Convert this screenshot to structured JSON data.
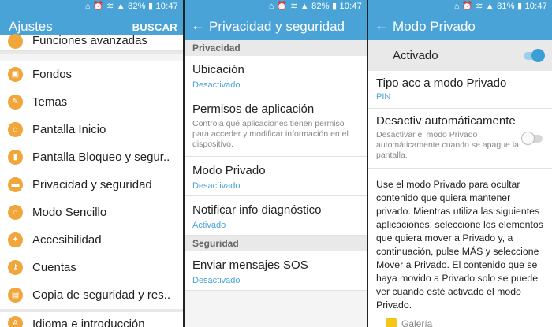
{
  "status": {
    "left_text": "⌂ ⏰ ≋ ▲ 82% ▮ 10:47",
    "mid_text": "⌂ ⏰ ≋ ▲ 82% ▮ 10:47",
    "right_text": "⌂ ⏰ ≋ ▲ 81% ▮ 10:47"
  },
  "colors": {
    "accent": "#4aa3d6",
    "icon": "#f0a63a"
  },
  "settings": {
    "title": "Ajustes",
    "search_label": "BUSCAR",
    "partial_top": "Funciones avanzadas",
    "items": [
      {
        "label": "Fondos",
        "icon": "wallpaper-icon"
      },
      {
        "label": "Temas",
        "icon": "brush-icon"
      },
      {
        "label": "Pantalla Inicio",
        "icon": "home-icon"
      },
      {
        "label": "Pantalla Bloqueo y segur..",
        "icon": "lock-icon"
      },
      {
        "label": "Privacidad y seguridad",
        "icon": "shield-icon"
      },
      {
        "label": "Modo Sencillo",
        "icon": "home-easy-icon"
      },
      {
        "label": "Accesibilidad",
        "icon": "accessibility-icon"
      },
      {
        "label": "Cuentas",
        "icon": "key-icon"
      },
      {
        "label": "Copia de seguridad y res..",
        "icon": "backup-icon"
      }
    ],
    "partial_bottom": "Idioma e introducción"
  },
  "privacy": {
    "title": "Privacidad y seguridad",
    "section_privacy": "Privacidad",
    "section_security": "Seguridad",
    "location": {
      "title": "Ubicación",
      "value": "Desactivado"
    },
    "permissions": {
      "title": "Permisos de aplicación",
      "desc": "Controla qué aplicaciones tienen permiso para acceder y modificar información en el dispositivo."
    },
    "private_mode": {
      "title": "Modo Privado",
      "value": "Desactivado"
    },
    "diagnostics": {
      "title": "Notificar info diagnóstico",
      "value": "Activado"
    },
    "sos": {
      "title": "Enviar mensajes SOS",
      "value": "Desactivado"
    }
  },
  "private": {
    "title": "Modo Privado",
    "master_label": "Activado",
    "master_on": true,
    "access_type": {
      "title": "Tipo acc a modo Privado",
      "value": "PIN"
    },
    "auto_off": {
      "title": "Desactiv automáticamente",
      "desc": "Desactivar el modo Privado automáticamente cuando se apague la pantalla.",
      "on": false
    },
    "info": "Use el modo Privado para ocultar contenido que quiera mantener privado. Mientras utiliza las siguientes aplicaciones, seleccione los elementos que quiera mover a Privado y, a continuación, pulse MÁS y seleccione Mover a Privado. El contenido que se haya movido a Privado solo se puede ver cuando esté activado el modo Privado.",
    "app_gallery": "Galería"
  }
}
